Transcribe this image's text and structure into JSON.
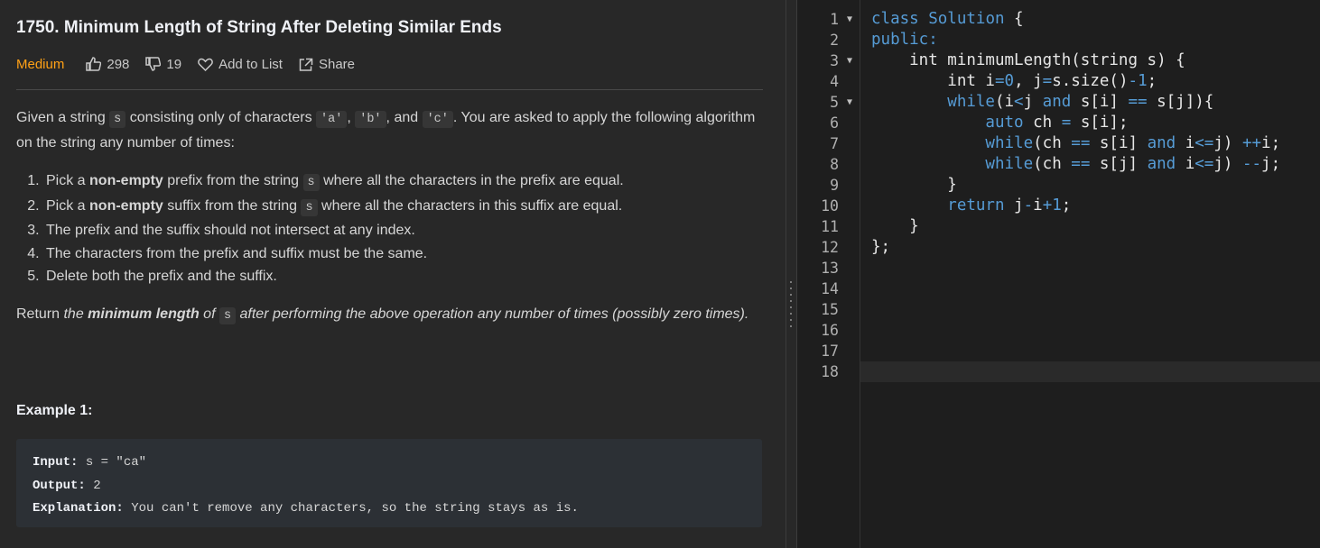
{
  "problem": {
    "title": "1750. Minimum Length of String After Deleting Similar Ends",
    "difficulty": "Medium",
    "likes": "298",
    "dislikes": "19",
    "add_to_list": "Add to List",
    "share": "Share",
    "intro": {
      "p1": "Given a string ",
      "c1": "s",
      "p2": " consisting only of characters ",
      "c2": "'a'",
      "p3": ", ",
      "c3": "'b'",
      "p4": ", and ",
      "c4": "'c'",
      "p5": ". You are asked to apply the following algorithm on the string any number of times:"
    },
    "steps": [
      {
        "a": "Pick a ",
        "b": "non-empty",
        "c": " prefix from the string ",
        "code": "s",
        "d": " where all the characters in the prefix are equal."
      },
      {
        "a": "Pick a ",
        "b": "non-empty",
        "c": " suffix from the string ",
        "code": "s",
        "d": " where all the characters in this suffix are equal."
      },
      {
        "text": "The prefix and the suffix should not intersect at any index."
      },
      {
        "text": "The characters from the prefix and suffix must be the same."
      },
      {
        "text": "Delete both the prefix and the suffix."
      }
    ],
    "return": {
      "a": "Return ",
      "b": "the ",
      "c": "minimum length",
      "d": " of ",
      "code": "s",
      "e": " after performing the above operation any number of times (possibly zero times)."
    },
    "example_title": "Example 1:",
    "example": {
      "input_label": "Input:",
      "input_value": " s = \"ca\"",
      "output_label": "Output:",
      "output_value": " 2",
      "explanation_label": "Explanation:",
      "explanation_value": " You can't remove any characters, so the string stays as is."
    }
  },
  "editor": {
    "line_numbers": [
      "1",
      "2",
      "3",
      "4",
      "5",
      "6",
      "7",
      "8",
      "9",
      "10",
      "11",
      "12",
      "13",
      "14",
      "15",
      "16",
      "17",
      "18"
    ],
    "fold_lines": [
      "1",
      "3",
      "5"
    ],
    "code": {
      "l1_kw": "class",
      "l1_name": " Solution",
      "l1_rest": " {",
      "l2": "public:",
      "l3_a": "    int minimumLength(string s) {",
      "l4_a": "        int i",
      "l4_op1": "=",
      "l4_n0": "0",
      "l4_b": ", j",
      "l4_op2": "=",
      "l4_c": "s.size()",
      "l4_op3": "-",
      "l4_n1": "1",
      "l4_d": ";",
      "l5_kw": "        while",
      "l5_a": "(i",
      "l5_op1": "<",
      "l5_b": "j ",
      "l5_and": "and",
      "l5_c": " s[i] ",
      "l5_op2": "==",
      "l5_d": " s[j]){",
      "l6_kw": "            auto",
      "l6_a": " ch ",
      "l6_op": "=",
      "l6_b": " s[i];",
      "l7_kw": "            while",
      "l7_a": "(ch ",
      "l7_op1": "==",
      "l7_b": " s[i] ",
      "l7_and": "and",
      "l7_c": " i",
      "l7_op2": "<=",
      "l7_d": "j) ",
      "l7_op3": "++",
      "l7_e": "i;",
      "l8_kw": "            while",
      "l8_a": "(ch ",
      "l8_op1": "==",
      "l8_b": " s[j] ",
      "l8_and": "and",
      "l8_c": " i",
      "l8_op2": "<=",
      "l8_d": "j) ",
      "l8_op3": "--",
      "l8_e": "j;",
      "l9": "        }",
      "l10_kw": "        return",
      "l10_a": " j",
      "l10_op1": "-",
      "l10_b": "i",
      "l10_op2": "+",
      "l10_n": "1",
      "l10_c": ";",
      "l11": "    }",
      "l12": "};"
    }
  },
  "colors": {
    "difficulty": "#ffa116",
    "keyword": "#569cd6",
    "editor_bg": "#1e1e1e",
    "panel_bg": "#282828"
  }
}
